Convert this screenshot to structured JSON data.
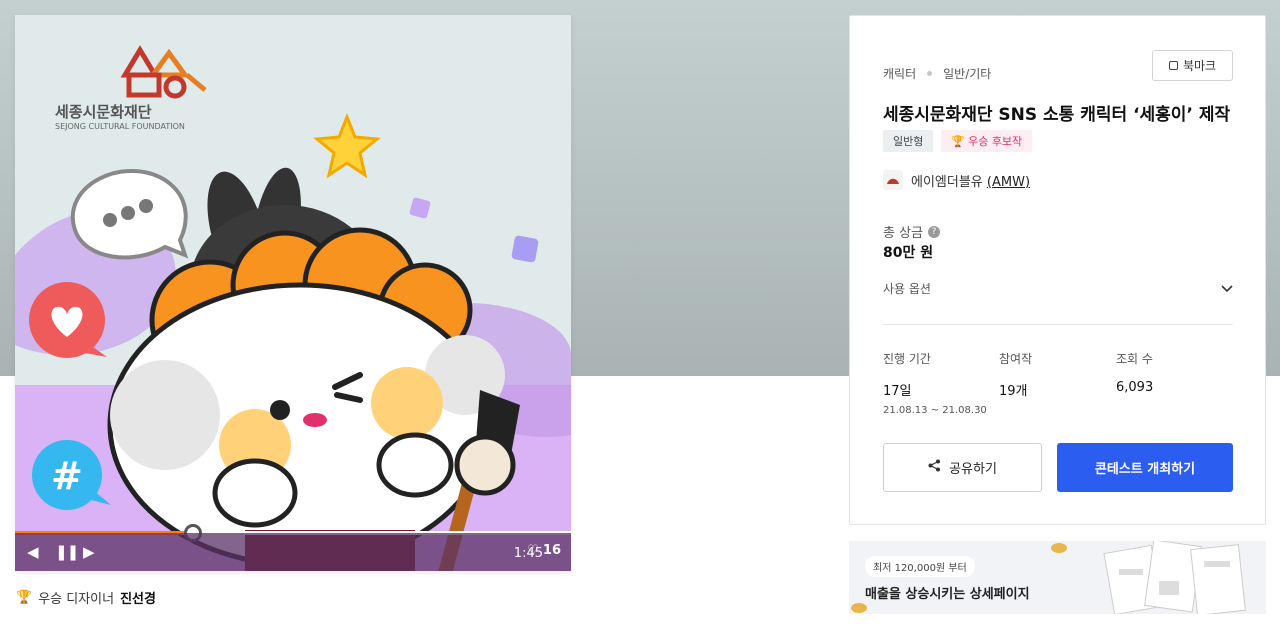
{
  "artwork": {
    "org_name_ko": "세종시문화재단",
    "org_name_en": "SEJONG CULTURAL FOUNDATION",
    "player": {
      "progress_fraction": 0.32,
      "time": "1:45",
      "likes": "16"
    }
  },
  "designer": {
    "label": "우승 디자이너",
    "name": "진선경"
  },
  "info": {
    "category": "캐릭터",
    "subcategory": "일반/기타",
    "bookmark_label": "북마크",
    "title": "세종시문화재단 SNS 소통 캐릭터 ‘세홍이’ 제작",
    "badge_type": "일반형",
    "badge_award": "우승 후보작",
    "company_name": "에이엠더블유 ",
    "company_handle": "(AMW)",
    "prize_label": "총 상금",
    "prize_help": "?",
    "prize_value": "80만 원",
    "usage_label": "사용 옵션",
    "stats": {
      "period_label": "진행 기간",
      "period_value": "17일",
      "period_range": "21.08.13 ~ 21.08.30",
      "entries_label": "참여작",
      "entries_value": "19개",
      "views_label": "조회 수",
      "views_value": "6,093"
    },
    "share_label": "공유하기",
    "host_label": "콘테스트 개최하기"
  },
  "ad": {
    "pill": "최저 120,000원 부터",
    "text": "매출을 상승시키는 상세페이지"
  },
  "colors": {
    "primary": "#2b5df0",
    "award": "#e0306e",
    "progress": "#ff7a1a"
  }
}
